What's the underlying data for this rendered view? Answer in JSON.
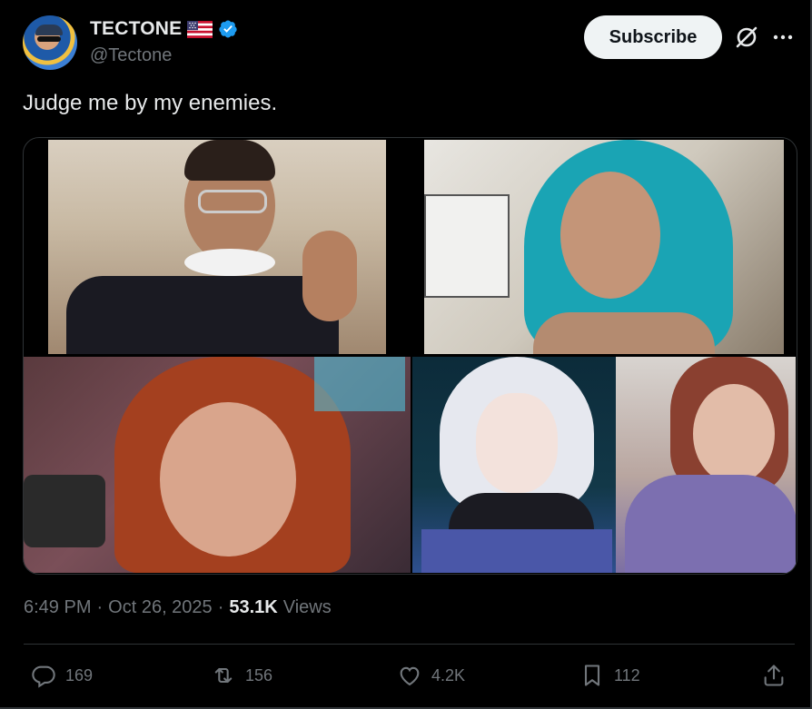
{
  "author": {
    "name": "TECTONE",
    "handle": "@Tectone",
    "verified": true,
    "flag": "us-flag"
  },
  "header": {
    "subscribe_label": "Subscribe",
    "grok_icon": "grok-icon",
    "more_icon": "more-icon"
  },
  "tweet": {
    "text": "Judge me by my enemies."
  },
  "media": {
    "count": 5,
    "layout": "2-top-3-bottom-grid"
  },
  "meta": {
    "time": "6:49 PM",
    "sep1": "·",
    "date": "Oct 26, 2025",
    "sep2": "·",
    "views_count": "53.1K",
    "views_label": "Views"
  },
  "actions": {
    "replies": "169",
    "reposts": "156",
    "likes": "4.2K",
    "bookmarks": "112"
  },
  "colors": {
    "background": "#000000",
    "text_primary": "#e7e9ea",
    "text_secondary": "#71767b",
    "verified_blue": "#1d9bf0",
    "button_bg": "#eff3f4",
    "border": "#2f3336"
  }
}
